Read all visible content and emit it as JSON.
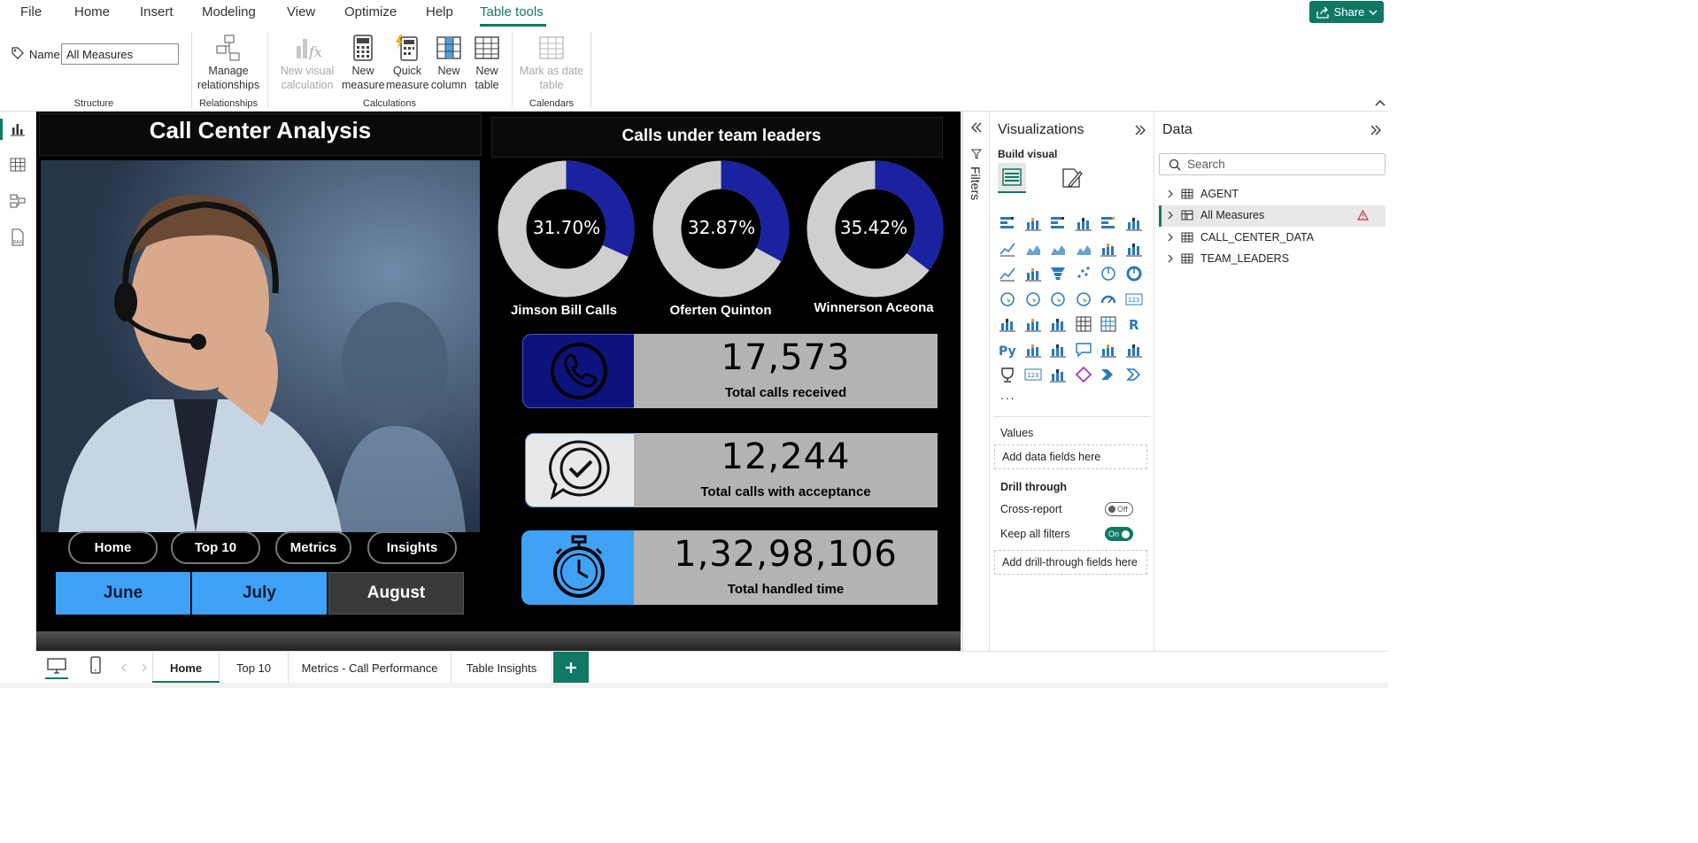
{
  "menu": {
    "items": [
      "File",
      "Home",
      "Insert",
      "Modeling",
      "View",
      "Optimize",
      "Help",
      "Table tools"
    ],
    "share_label": "Share"
  },
  "ribbon": {
    "name_label": "Name",
    "name_value": "All Measures",
    "groups": {
      "structure": "Structure",
      "relationships": "Relationships",
      "calculations": "Calculations",
      "calendars": "Calendars"
    },
    "buttons": {
      "manage_rel_1": "Manage",
      "manage_rel_2": "relationships",
      "new_visual_calc_1": "New visual",
      "new_visual_calc_2": "calculation",
      "new_measure_1": "New",
      "new_measure_2": "measure",
      "quick_measure_1": "Quick",
      "quick_measure_2": "measure",
      "new_column_1": "New",
      "new_column_2": "column",
      "new_table_1": "New",
      "new_table_2": "table",
      "mark_date_1": "Mark as date",
      "mark_date_2": "table"
    }
  },
  "report": {
    "title": "Call Center Analysis",
    "right_title": "Calls under team leaders",
    "nav_buttons": [
      "Home",
      "Top 10",
      "Metrics",
      "Insights"
    ],
    "months": [
      "June",
      "July",
      "August"
    ],
    "donuts": [
      {
        "label": "Jimson Bill Calls",
        "pct_text": "31.70%",
        "value": 0.317
      },
      {
        "label": "Oferten Quinton",
        "pct_text": "32.87%",
        "value": 0.3287
      },
      {
        "label": "Winnerson Aceona",
        "pct_text": "35.42%",
        "value": 0.3542
      }
    ],
    "kpis": [
      {
        "value": "17,573",
        "label": "Total calls received",
        "icon": "phone-icon"
      },
      {
        "value": "12,244",
        "label": "Total calls with acceptance",
        "icon": "checkmark-chat-icon"
      },
      {
        "value": "1,32,98,106",
        "label": "Total handled time",
        "icon": "stopwatch-icon"
      }
    ]
  },
  "filters": {
    "label": "Filters"
  },
  "visualizations": {
    "title": "Visualizations",
    "build_visual": "Build visual",
    "more": "...",
    "values_label": "Values",
    "values_placeholder": "Add data fields here",
    "drill_through": "Drill through",
    "cross_report": "Cross-report",
    "cross_report_state": "Off",
    "keep_filters": "Keep all filters",
    "keep_filters_state": "On",
    "drill_placeholder": "Add drill-through fields here"
  },
  "data": {
    "title": "Data",
    "search_placeholder": "Search",
    "tables": [
      "AGENT",
      "All Measures",
      "CALL_CENTER_DATA",
      "TEAM_LEADERS"
    ]
  },
  "tabs": [
    "Home",
    "Top 10",
    "Metrics - Call Performance",
    "Table Insights"
  ],
  "colors": {
    "accent": "#117865",
    "donut_fill": "#1a22a0",
    "donut_track": "#cfcfcf",
    "month_active": "#3fa2f7",
    "month_inactive": "#3a3a3a",
    "kpi_dark_blue": "#0d137d",
    "kpi_light_blue": "#3fa2f7",
    "kpi_value_bg": "#b3b3b3"
  }
}
